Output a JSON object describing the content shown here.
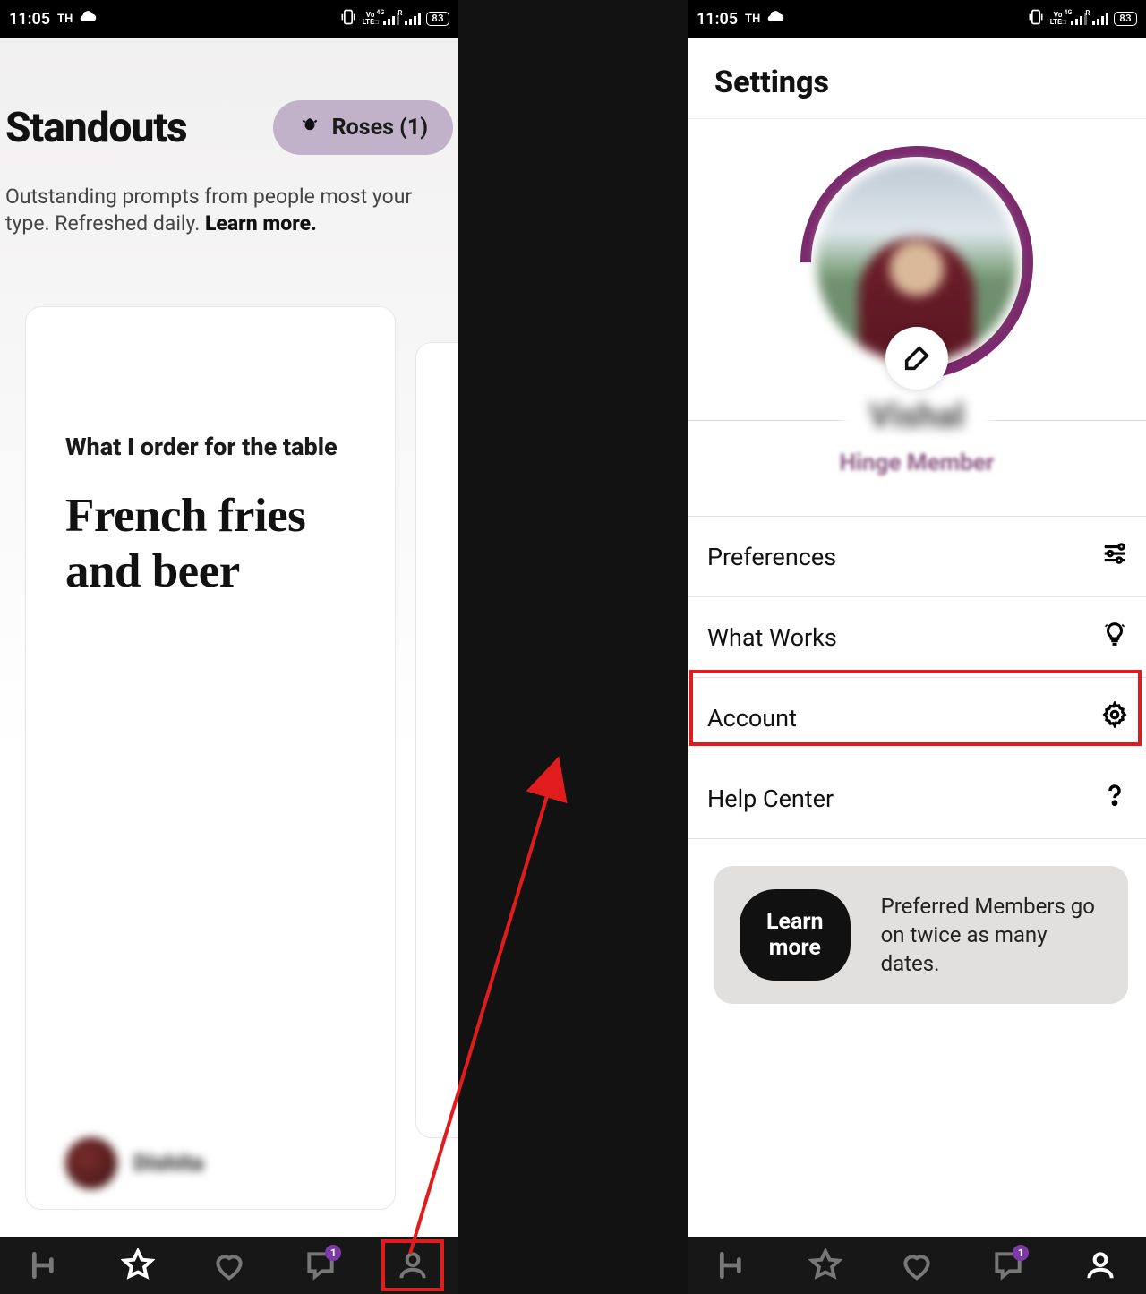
{
  "statusbar": {
    "time": "11:05",
    "carrier": "TH",
    "vo_label_top": "Vo",
    "vo_label_bot": "LTE□",
    "net4g": "4G",
    "roam": "R",
    "battery": "83"
  },
  "left": {
    "title": "Standouts",
    "roses_label": "Roses (1)",
    "subtext_prefix": "Outstanding prompts from people most your type. Refreshed daily. ",
    "subtext_learn": "Learn more.",
    "prompt_question": "What I order for the table",
    "prompt_answer": "French fries and beer",
    "card_username": "Dishita",
    "nav_badge_messages": "1"
  },
  "right": {
    "settings_title": "Settings",
    "profile_name": "Vishal",
    "member_type": "Hinge Member",
    "menu": {
      "preferences": "Preferences",
      "what_works": "What Works",
      "account": "Account",
      "help_center": "Help Center"
    },
    "promo": {
      "button": "Learn more",
      "text": "Preferred Members go on twice as many dates."
    },
    "nav_badge_messages": "1"
  }
}
